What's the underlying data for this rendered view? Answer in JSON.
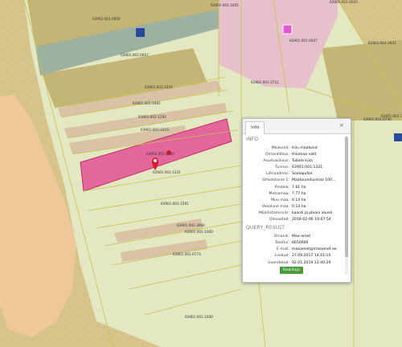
{
  "map": {
    "parcel_labels": [
      {
        "id": "lbl-0000",
        "text": "63901:001:0000"
      },
      {
        "id": "lbl-0007",
        "text": "63901:001:0007"
      },
      {
        "id": "lbl-0007b",
        "text": "63901:001:0007"
      },
      {
        "id": "lbl-0003",
        "text": "63901:001:0003"
      },
      {
        "id": "lbl-1005",
        "text": "63901:001:1005"
      },
      {
        "id": "lbl-3712",
        "text": "63901:001:3712"
      },
      {
        "id": "lbl-1024",
        "text": "63901:001:1024"
      },
      {
        "id": "lbl-4081",
        "text": "63901:001:4081"
      },
      {
        "id": "lbl-1292",
        "text": "63901:001:1292"
      },
      {
        "id": "lbl-1015",
        "text": "63901:001:1015"
      },
      {
        "id": "lbl-1320",
        "text": "63901:001:1320"
      },
      {
        "id": "lbl-1331",
        "text": "63901:001:1331"
      },
      {
        "id": "lbl-1591",
        "text": "63901:001:1591"
      },
      {
        "id": "lbl-3960",
        "text": "63901:001:3960"
      },
      {
        "id": "lbl-1060",
        "text": "63901:001:1060"
      },
      {
        "id": "lbl-0773",
        "text": "63901:001:0773"
      },
      {
        "id": "lbl-1000",
        "text": "63901:001:1000"
      },
      {
        "id": "lbl-3962",
        "text": "63901:001:3962"
      },
      {
        "id": "lbl-3931",
        "text": "63901:001:3931"
      },
      {
        "id": "lbl-0700",
        "text": "63901:001:0700"
      }
    ],
    "colors": {
      "background_land": "#d7c48a",
      "parcel_fill": "#e3e7c2",
      "forest_parcel": "#c2b575",
      "road_strip": "#9db1a0",
      "highlight_parcel": "#e3679a",
      "pink_parcel": "#e6c1cc",
      "sandy_area": "#efc89a",
      "marker_red": "#d81e34"
    },
    "markers": [
      {
        "id": "blue-square-1",
        "color": "#28489b"
      },
      {
        "id": "blue-square-2",
        "color": "#28489b"
      },
      {
        "id": "magenta-square",
        "color": "#e357d0"
      }
    ]
  },
  "popup": {
    "tab_label": "Info",
    "close_symbol": "×",
    "section_info": "INFO",
    "rows": [
      {
        "key": "Maakond:",
        "value": "Hiiu maakond"
      },
      {
        "key": "Omavalitsus:",
        "value": "Hiiumaa vald"
      },
      {
        "key": "Asustusüksus:",
        "value": "Tubala küla"
      },
      {
        "key": "Tunnus:",
        "value": "63901:001:1321"
      },
      {
        "key": "Lähiaadress:",
        "value": "Soolaputke"
      },
      {
        "key": "Sihtotstarve 1:",
        "value": "Maatulundusmaa 100..."
      },
      {
        "key": "Pindala:",
        "value": "7.61 ha"
      },
      {
        "key": "Metsamaa:",
        "value": "7.77 ha"
      },
      {
        "key": "Muu maa:",
        "value": "0.14 ha"
      },
      {
        "key": "Veealune maa:",
        "value": "0.14 ha"
      },
      {
        "key": "Mõõdistamisviis:",
        "value": "kaardi ja plaani alusel"
      },
      {
        "key": "Ülevaated:",
        "value": "2018-02-06 10:07:54"
      }
    ],
    "section_query": "QUERY_RESULT",
    "query_rows": [
      {
        "key": "Omanik:",
        "value": "Maa-amet"
      },
      {
        "key": "Telefon:",
        "value": "6650600"
      },
      {
        "key": "E-mail:",
        "value": "maaamet@maaamet.ee"
      },
      {
        "key": "Lisatud:",
        "value": "27.09.2017 14:41:10"
      },
      {
        "key": "Uuendatud:",
        "value": "02.01.2019 13:40:29"
      }
    ],
    "zoom_button": "Keskitaja"
  }
}
